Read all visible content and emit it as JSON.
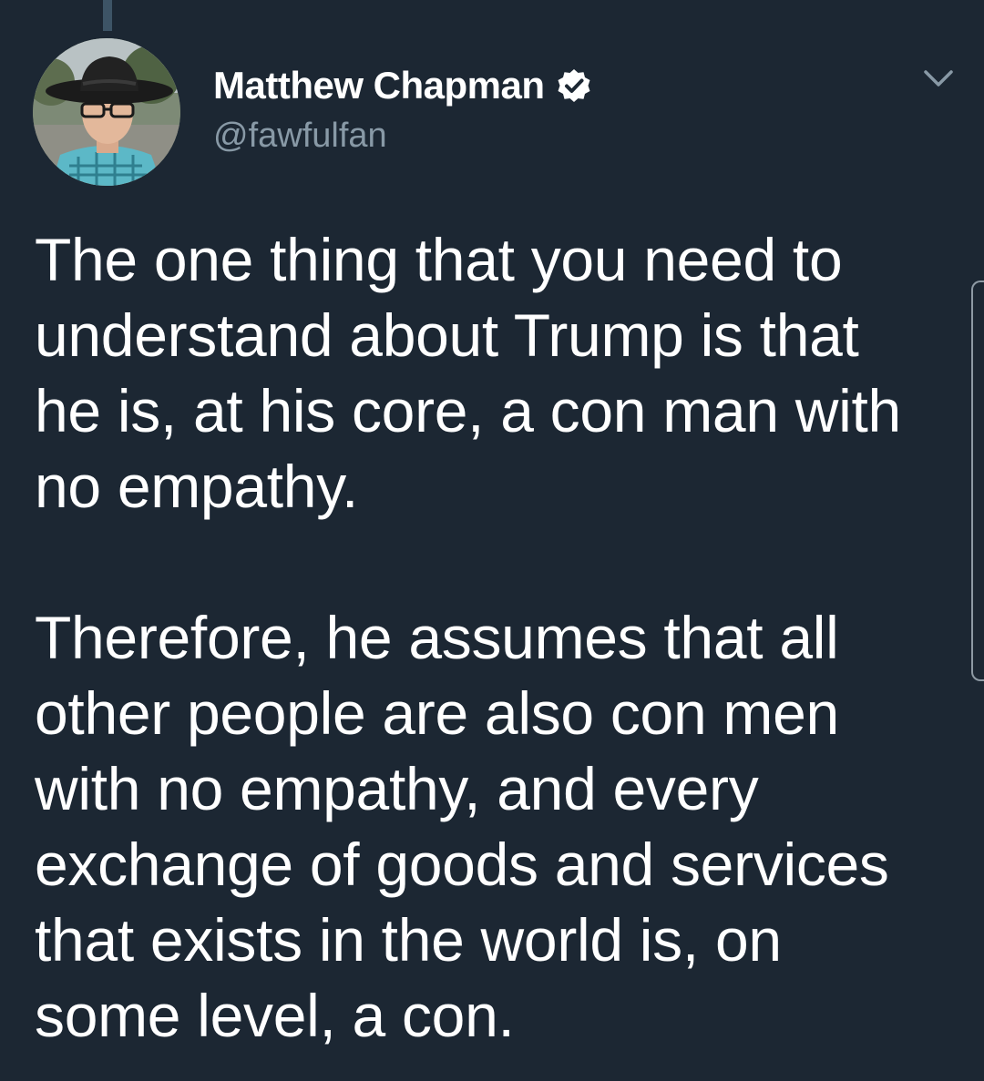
{
  "tweet": {
    "author": {
      "display_name": "Matthew Chapman",
      "handle": "@fawfulfan",
      "verified": true,
      "avatar_icon": "profile-photo"
    },
    "text": "The one thing that you need to understand about Trump is that he is, at his core, a con man with no empathy.\n\nTherefore, he assumes that all other people are also con men with no empathy, and every exchange of goods and services that exists in the world is, on some level, a con."
  },
  "colors": {
    "background": "#1c2733",
    "text_primary": "#ffffff",
    "text_secondary": "#8899a6",
    "thread_line": "#3d5466"
  }
}
